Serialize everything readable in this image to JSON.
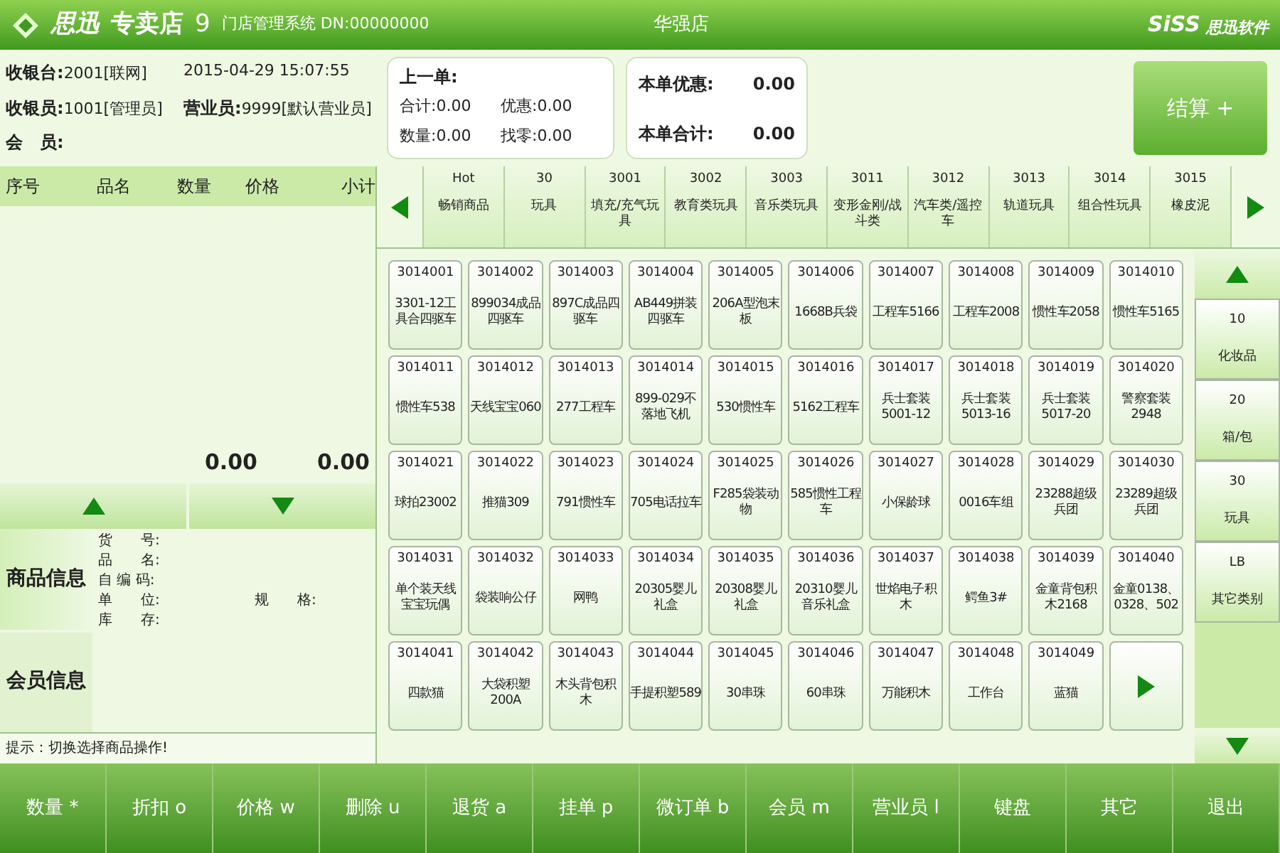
{
  "header": {
    "brand": "思迅",
    "product": "专卖店",
    "version": "9",
    "system": "门店管理系统 DN:00000000",
    "store": "华强店",
    "vendor_logo": "SiSS",
    "vendor_name": "思迅软件"
  },
  "info": {
    "fields": [
      {
        "label": "收银台:",
        "value": "2001[联网]"
      },
      {
        "value": "2015-04-29 15:07:55"
      },
      {
        "label": "收银员:",
        "value": "1001[管理员]"
      },
      {
        "label": "营业员:",
        "value": "9999[默认营业员]"
      },
      {
        "label": "会　员:"
      }
    ]
  },
  "last_bill": {
    "title": "上一单:",
    "items": [
      {
        "label": "合计:",
        "value": "0.00"
      },
      {
        "label": "优惠:",
        "value": "0.00"
      },
      {
        "label": "数量:",
        "value": "0.00"
      },
      {
        "label": "找零:",
        "value": "0.00"
      }
    ]
  },
  "current_bill": [
    {
      "label": "本单优惠:",
      "value": "0.00"
    },
    {
      "label": "本单合计:",
      "value": "0.00"
    }
  ],
  "checkout_button": "结算 +",
  "table": {
    "columns": [
      "序号",
      "品名",
      "数量",
      "价格",
      "小计"
    ],
    "total_qty": "0.00",
    "total_amount": "0.00"
  },
  "detail_tabs": [
    {
      "label": "商品信息",
      "selected": true
    },
    {
      "label": "会员信息",
      "selected": false
    }
  ],
  "detail_fields": [
    {
      "label": "货　　号:"
    },
    {
      "label": "品　　名:"
    },
    {
      "label": "自 编 码:"
    },
    {
      "label": "单　　位:",
      "extra": "规　　格:"
    },
    {
      "label": "库　　存:"
    }
  ],
  "hint": "提示：切换选择商品操作!",
  "categories": [
    {
      "code": "Hot",
      "name": "畅销商品"
    },
    {
      "code": "30",
      "name": "玩具"
    },
    {
      "code": "3001",
      "name": "填充/充气玩具"
    },
    {
      "code": "3002",
      "name": "教育类玩具"
    },
    {
      "code": "3003",
      "name": "音乐类玩具"
    },
    {
      "code": "3011",
      "name": "变形金刚/战斗类"
    },
    {
      "code": "3012",
      "name": "汽车类/遥控车"
    },
    {
      "code": "3013",
      "name": "轨道玩具"
    },
    {
      "code": "3014",
      "name": "组合性玩具"
    },
    {
      "code": "3015",
      "name": "橡皮泥"
    }
  ],
  "products": [
    {
      "code": "3014001",
      "name": "3301-12工具合四驱车"
    },
    {
      "code": "3014002",
      "name": "899034成品四驱车"
    },
    {
      "code": "3014003",
      "name": "897C成品四驱车"
    },
    {
      "code": "3014004",
      "name": "AB449拼装四驱车"
    },
    {
      "code": "3014005",
      "name": "206A型泡末板"
    },
    {
      "code": "3014006",
      "name": "1668B兵袋"
    },
    {
      "code": "3014007",
      "name": "工程车5166"
    },
    {
      "code": "3014008",
      "name": "工程车2008"
    },
    {
      "code": "3014009",
      "name": "惯性车2058"
    },
    {
      "code": "3014010",
      "name": "惯性车5165"
    },
    {
      "code": "3014011",
      "name": "惯性车538"
    },
    {
      "code": "3014012",
      "name": "天线宝宝060"
    },
    {
      "code": "3014013",
      "name": "277工程车"
    },
    {
      "code": "3014014",
      "name": "899-029不落地飞机"
    },
    {
      "code": "3014015",
      "name": "530惯性车"
    },
    {
      "code": "3014016",
      "name": "5162工程车"
    },
    {
      "code": "3014017",
      "name": "兵士套装5001-12"
    },
    {
      "code": "3014018",
      "name": "兵士套装5013-16"
    },
    {
      "code": "3014019",
      "name": "兵士套装5017-20"
    },
    {
      "code": "3014020",
      "name": "警察套装2948"
    },
    {
      "code": "3014021",
      "name": "球拍23002"
    },
    {
      "code": "3014022",
      "name": "推猫309"
    },
    {
      "code": "3014023",
      "name": "791惯性车"
    },
    {
      "code": "3014024",
      "name": "705电话拉车"
    },
    {
      "code": "3014025",
      "name": "F285袋装动物"
    },
    {
      "code": "3014026",
      "name": "585惯性工程车"
    },
    {
      "code": "3014027",
      "name": "小保龄球"
    },
    {
      "code": "3014028",
      "name": "0016车组"
    },
    {
      "code": "3014029",
      "name": "23288超级兵团"
    },
    {
      "code": "3014030",
      "name": "23289超级兵团"
    },
    {
      "code": "3014031",
      "name": "单个装天线宝宝玩偶"
    },
    {
      "code": "3014032",
      "name": "袋装响公仔"
    },
    {
      "code": "3014033",
      "name": "网鸭"
    },
    {
      "code": "3014034",
      "name": "20305婴儿礼盒"
    },
    {
      "code": "3014035",
      "name": "20308婴儿礼盒"
    },
    {
      "code": "3014036",
      "name": "20310婴儿音乐礼盒"
    },
    {
      "code": "3014037",
      "name": "世焰电子积木"
    },
    {
      "code": "3014038",
      "name": "鳄鱼3#"
    },
    {
      "code": "3014039",
      "name": "金童背包积木2168"
    },
    {
      "code": "3014040",
      "name": "金童0138、0328、502"
    },
    {
      "code": "3014041",
      "name": "四款猫"
    },
    {
      "code": "3014042",
      "name": "大袋积塑200A"
    },
    {
      "code": "3014043",
      "name": "木头背包积木"
    },
    {
      "code": "3014044",
      "name": "手提积塑589"
    },
    {
      "code": "3014045",
      "name": "30串珠"
    },
    {
      "code": "3014046",
      "name": "60串珠"
    },
    {
      "code": "3014047",
      "name": "万能积木"
    },
    {
      "code": "3014048",
      "name": "工作台"
    },
    {
      "code": "3014049",
      "name": "蓝猫"
    }
  ],
  "side_categories": [
    {
      "code": "10",
      "name": "化妆品"
    },
    {
      "code": "20",
      "name": "箱/包"
    },
    {
      "code": "30",
      "name": "玩具"
    },
    {
      "code": "LB",
      "name": "其它类别"
    }
  ],
  "function_keys": [
    "数量 *",
    "折扣 o",
    "价格 w",
    "删除 u",
    "退货 a",
    "挂单 p",
    "微订单 b",
    "会员 m",
    "营业员 l",
    "键盘",
    "其它",
    "退出"
  ]
}
